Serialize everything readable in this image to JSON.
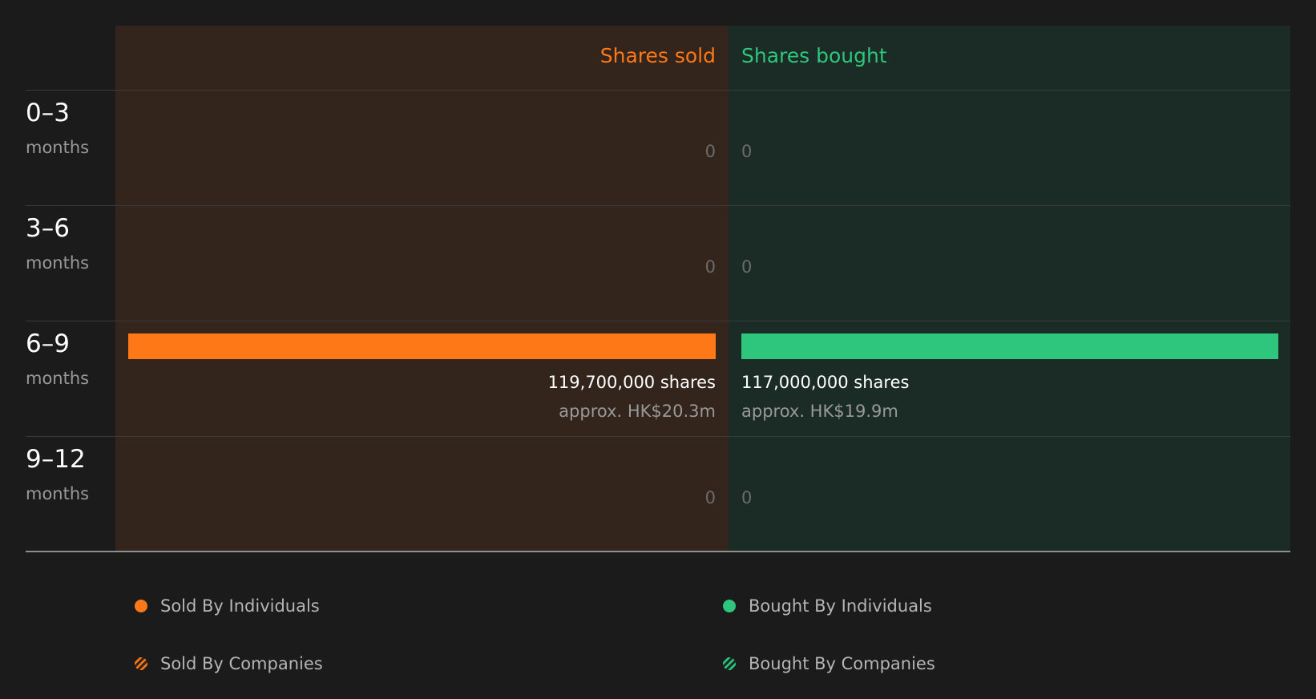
{
  "colors": {
    "background": "#1b1b1b",
    "sold_panel": "#33241c",
    "bought_panel": "#1b2b25",
    "sold": "#ff7817",
    "bought": "#2ec67c"
  },
  "chart_data": {
    "type": "bar",
    "headers": {
      "sold": "Shares sold",
      "bought": "Shares bought"
    },
    "categories": [
      {
        "period": "0–3",
        "unit": "months"
      },
      {
        "period": "3–6",
        "unit": "months"
      },
      {
        "period": "6–9",
        "unit": "months"
      },
      {
        "period": "9–12",
        "unit": "months"
      }
    ],
    "series": [
      {
        "name": "Shares sold",
        "values": [
          0,
          0,
          119700000,
          0
        ],
        "labels": [
          "0",
          "0",
          "119,700,000 shares",
          "0"
        ],
        "approx": [
          "",
          "",
          "approx. HK$20.3m",
          ""
        ]
      },
      {
        "name": "Shares bought",
        "values": [
          0,
          0,
          117000000,
          0
        ],
        "labels": [
          "0",
          "0",
          "117,000,000 shares",
          "0"
        ],
        "approx": [
          "",
          "",
          "approx. HK$19.9m",
          ""
        ]
      }
    ],
    "legend": [
      {
        "label": "Sold By Individuals",
        "style": "solid",
        "color": "#ff7817"
      },
      {
        "label": "Bought By Individuals",
        "style": "solid",
        "color": "#2ec67c"
      },
      {
        "label": "Sold By Companies",
        "style": "hatched",
        "color": "#ff7817"
      },
      {
        "label": "Bought By Companies",
        "style": "hatched",
        "color": "#2ec67c"
      }
    ]
  }
}
